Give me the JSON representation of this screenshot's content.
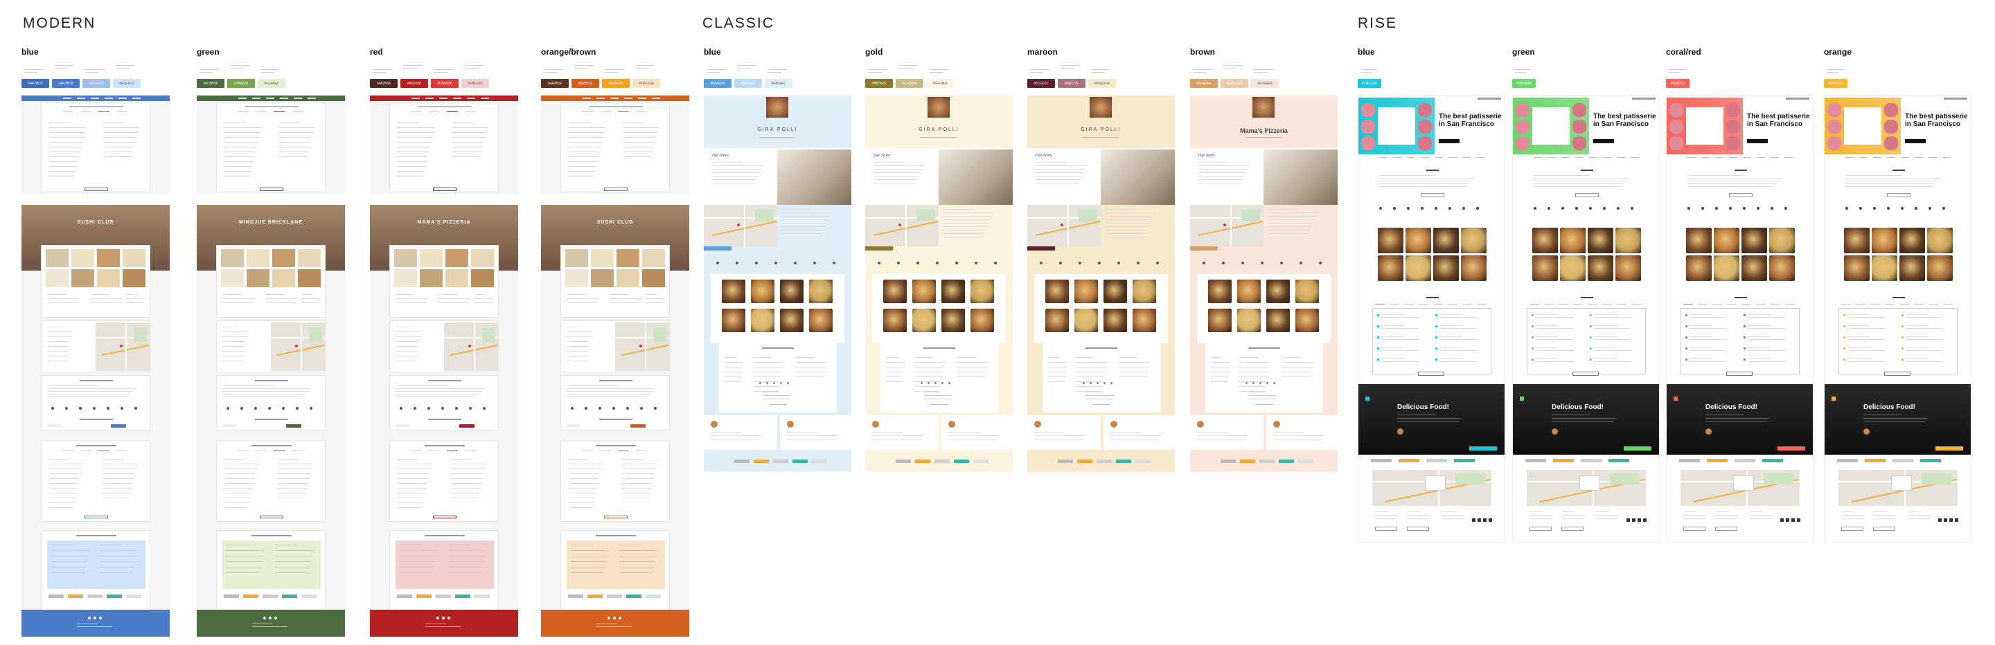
{
  "groups": {
    "modern": "MODERN",
    "classic": "CLASSIC",
    "rise": "RISE"
  },
  "themes": {
    "modern": [
      {
        "name": "blue",
        "accent": "#4A7BC8",
        "labels": [
          "",
          "",
          "",
          ""
        ],
        "swatches": [
          {
            "hex": "#4A7BC8",
            "color": "#3D6DB5"
          },
          {
            "hex": "#4A7BC8",
            "color": "#4A7BC8"
          },
          {
            "hex": "#A1C4E8",
            "color": "#9DC0E6"
          },
          {
            "hex": "#E3F1FD",
            "color": "#CFE4F8"
          }
        ]
      },
      {
        "name": "green",
        "accent": "#4C6B3F",
        "labels": [
          "",
          "",
          ""
        ],
        "swatches": [
          {
            "hex": "#4C6B3F",
            "color": "#4C6B3F"
          },
          {
            "hex": "#7AA653",
            "color": "#7AA653"
          },
          {
            "hex": "#F1F8E0",
            "color": "#E4F0D0"
          }
        ]
      },
      {
        "name": "red",
        "accent": "#B52020",
        "labels": [
          "",
          "",
          "",
          ""
        ],
        "swatches": [
          {
            "hex": "#4A2B1F",
            "color": "#4A2B1F"
          },
          {
            "hex": "#B52020",
            "color": "#B52020"
          },
          {
            "hex": "#D93A3A",
            "color": "#D93A3A"
          },
          {
            "hex": "#FBE3E3",
            "color": "#F5CFCF"
          }
        ]
      },
      {
        "name": "orange/brown",
        "accent": "#D2601E",
        "labels": [
          "",
          "",
          "",
          ""
        ],
        "swatches": [
          {
            "hex": "#4A2B1F",
            "color": "#5A3420"
          },
          {
            "hex": "#D2601E",
            "color": "#D2601E"
          },
          {
            "hex": "#F4A024",
            "color": "#F4A024"
          },
          {
            "hex": "#FDF1DE",
            "color": "#F8E4C4"
          }
        ]
      }
    ],
    "classic": [
      {
        "name": "blue",
        "accent": "#5AA0D6",
        "swatches": [
          {
            "hex": "#5AA0D6",
            "color": "#5AA0D6"
          },
          {
            "hex": "#B8DAF2",
            "color": "#B8DAF2"
          },
          {
            "hex": "#E8F4FC",
            "color": "#E0EEF8"
          }
        ]
      },
      {
        "name": "gold",
        "accent": "#8B7A2E",
        "swatches": [
          {
            "hex": "#8B7A2E",
            "color": "#8B7A2E"
          },
          {
            "hex": "#C9B98A",
            "color": "#C9B98A"
          },
          {
            "hex": "#FFF9EA",
            "color": "#FAF3DE"
          }
        ]
      },
      {
        "name": "maroon",
        "accent": "#5C1E2C",
        "swatches": [
          {
            "hex": "#5C1E2C",
            "color": "#5C1E2C"
          },
          {
            "hex": "#A8727E",
            "color": "#A8727E"
          },
          {
            "hex": "#F8EDD4",
            "color": "#F6EACB"
          }
        ]
      },
      {
        "name": "brown",
        "accent": "#D9A066",
        "swatches": [
          {
            "hex": "#D9A066",
            "color": "#D9A066"
          },
          {
            "hex": "#EBCCAA",
            "color": "#EBCCAA"
          },
          {
            "hex": "#FDEEE6",
            "color": "#FBE6DC"
          }
        ]
      }
    ],
    "rise": [
      {
        "name": "blue",
        "accent": "#1BC6D6",
        "swatches": [
          {
            "hex": "#1BC6D6",
            "color": "#1BC6D6"
          }
        ]
      },
      {
        "name": "green",
        "accent": "#6BD66B",
        "swatches": [
          {
            "hex": "#6BD66B",
            "color": "#6BD66B"
          }
        ]
      },
      {
        "name": "coral/red",
        "accent": "#F5655C",
        "swatches": [
          {
            "hex": "#F5655C",
            "color": "#F5655C"
          }
        ]
      },
      {
        "name": "orange",
        "accent": "#F5B535",
        "swatches": [
          {
            "hex": "#F5B535",
            "color": "#F5B535"
          }
        ]
      }
    ]
  },
  "modern_hero": [
    "SUSHI CLUB",
    "MINGJUE BRICKLANE",
    "MAMA'S PIZZERIA",
    "SUSHI CLUB"
  ],
  "classic_hero": [
    "GIRA POLLI",
    "GIRA POLLI",
    "GIRA POLLI",
    "Mama's Pizzeria"
  ],
  "classic_story": "Our Story",
  "rise_hero": "The best patisserie in San Francisco",
  "rise_quote": "Delicious Food!"
}
